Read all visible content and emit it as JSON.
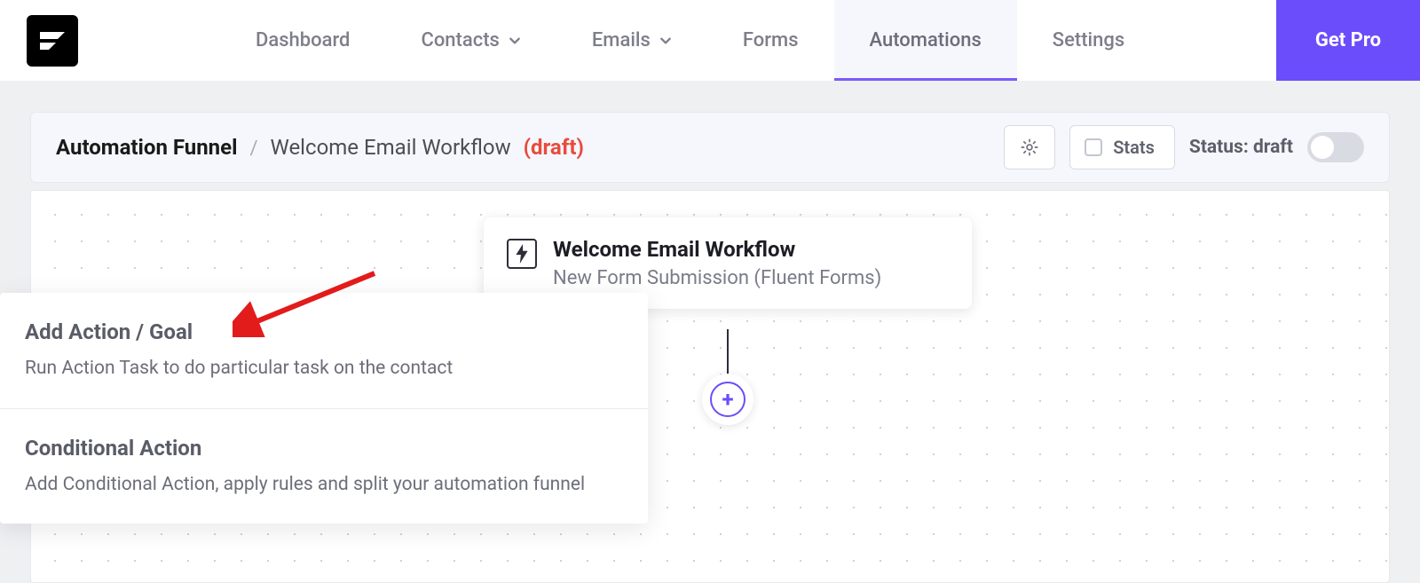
{
  "nav": {
    "items": [
      {
        "label": "Dashboard",
        "has_dropdown": false
      },
      {
        "label": "Contacts",
        "has_dropdown": true
      },
      {
        "label": "Emails",
        "has_dropdown": true
      },
      {
        "label": "Forms",
        "has_dropdown": false
      },
      {
        "label": "Automations",
        "has_dropdown": false,
        "active": true
      },
      {
        "label": "Settings",
        "has_dropdown": false
      }
    ],
    "cta": "Get Pro"
  },
  "toolbar": {
    "breadcrumb_root": "Automation Funnel",
    "breadcrumb_sep": "/",
    "workflow_name": "Welcome Email Workflow",
    "draft_tag": "(draft)",
    "stats_label": "Stats",
    "status_label": "Status: draft"
  },
  "node": {
    "title": "Welcome Email Workflow",
    "subtitle": "New Form Submission (Fluent Forms)"
  },
  "popup": {
    "items": [
      {
        "title": "Add Action / Goal",
        "desc": "Run Action Task to do particular task on the contact"
      },
      {
        "title": "Conditional Action",
        "desc": "Add Conditional Action, apply rules and split your automation funnel"
      }
    ]
  }
}
